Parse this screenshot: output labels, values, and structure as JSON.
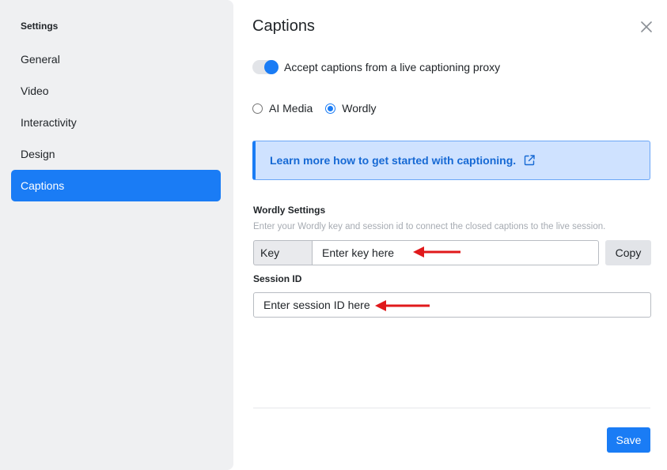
{
  "sidebar": {
    "title": "Settings",
    "items": [
      {
        "label": "General"
      },
      {
        "label": "Video"
      },
      {
        "label": "Interactivity"
      },
      {
        "label": "Design"
      },
      {
        "label": "Captions"
      }
    ]
  },
  "panel": {
    "title": "Captions",
    "toggle": {
      "label": "Accept captions from a live captioning proxy",
      "checked": true
    },
    "radio": {
      "options": [
        {
          "label": "AI Media",
          "checked": false
        },
        {
          "label": "Wordly",
          "checked": true
        }
      ]
    },
    "info_link": "Learn more how to get started with captioning.",
    "wordly": {
      "title": "Wordly Settings",
      "helper": "Enter your Wordly key and session id to connect the closed captions to the live session.",
      "key_label": "Key",
      "key_placeholder": "Enter key here",
      "copy_label": "Copy",
      "session_label": "Session ID",
      "session_placeholder": "Enter session ID here"
    },
    "save_label": "Save"
  },
  "colors": {
    "accent": "#1a7cf5",
    "sidebar_bg": "#eff0f2",
    "info_bg": "#cfe2ff",
    "annotation_arrow": "#e0191b"
  },
  "icons": [
    "close-icon",
    "external-link-icon",
    "annotation-arrow"
  ]
}
